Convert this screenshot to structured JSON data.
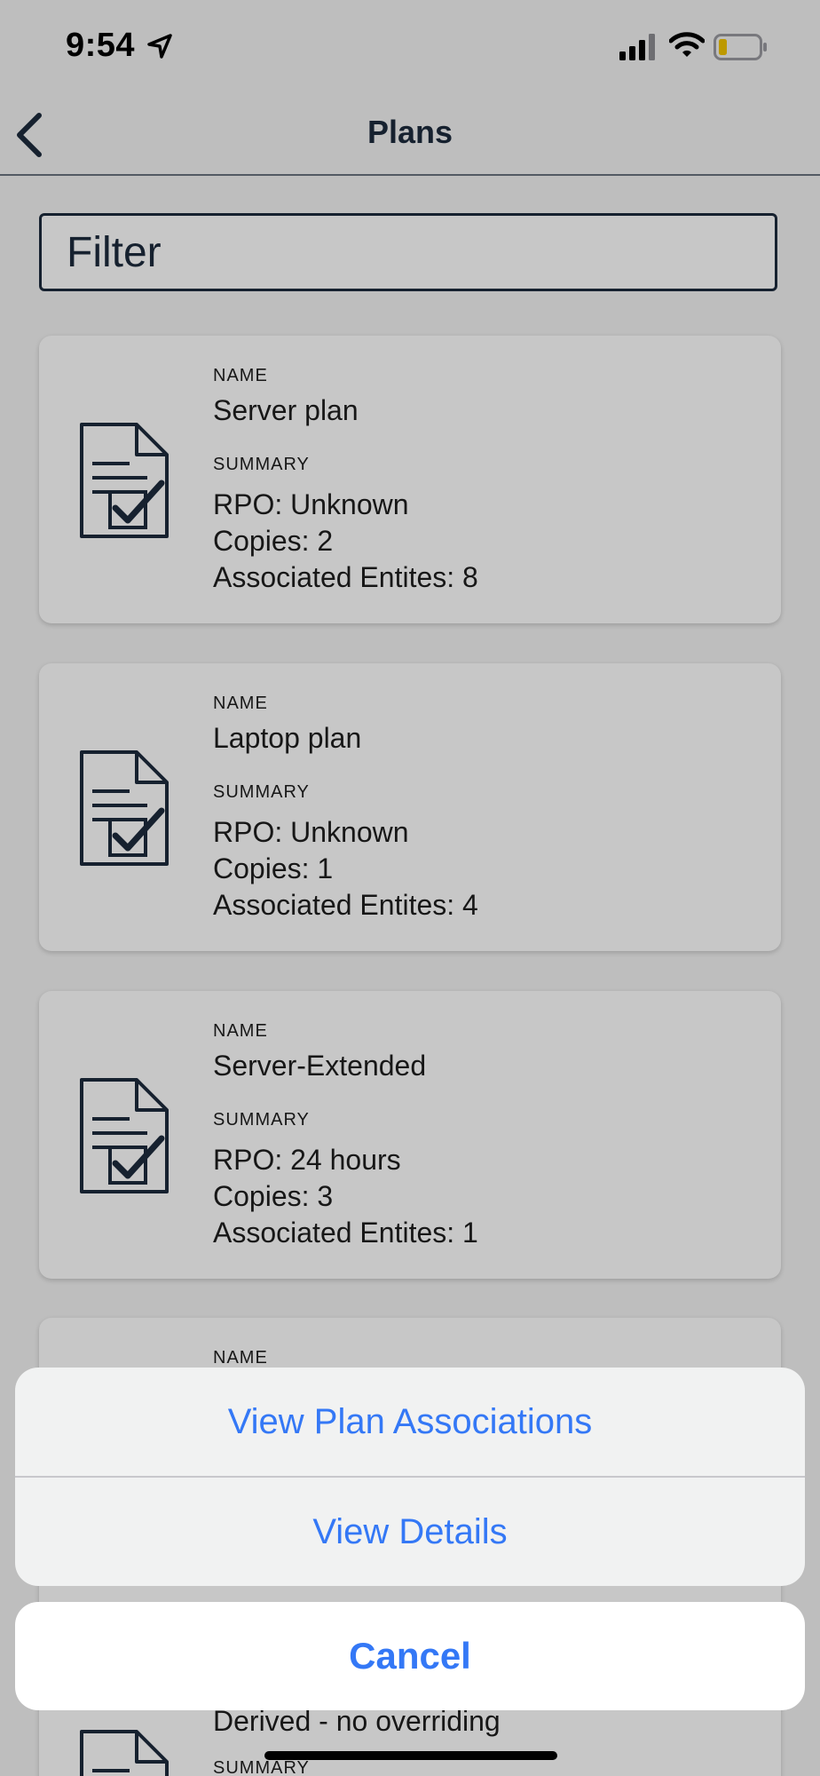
{
  "status_bar": {
    "time": "9:54",
    "icons": [
      "location-arrow-icon",
      "signal-icon",
      "wifi-icon",
      "battery-icon"
    ]
  },
  "nav": {
    "back_icon": "chevron-left-icon",
    "title": "Plans"
  },
  "filter": {
    "placeholder": "Filter"
  },
  "plans": [
    {
      "name_label": "NAME",
      "name": "Server plan",
      "summary_label": "SUMMARY",
      "rpo": "RPO: Unknown",
      "copies": "Copies: 2",
      "entities": "Associated Entites: 8"
    },
    {
      "name_label": "NAME",
      "name": "Laptop plan",
      "summary_label": "SUMMARY",
      "rpo": "RPO: Unknown",
      "copies": "Copies: 1",
      "entities": "Associated Entites: 4"
    },
    {
      "name_label": "NAME",
      "name": "Server-Extended",
      "summary_label": "SUMMARY",
      "rpo": "RPO: 24 hours",
      "copies": "Copies: 3",
      "entities": "Associated Entites: 1"
    }
  ],
  "partial_card": {
    "name_label": "NAME",
    "summary_text": "Derived - no overriding",
    "summary_label": "SUMMARY"
  },
  "action_sheet": {
    "view_associations": "View Plan Associations",
    "view_details": "View Details",
    "cancel": "Cancel"
  },
  "colors": {
    "accent": "#3478f6",
    "navy": "#1d2b3d"
  }
}
